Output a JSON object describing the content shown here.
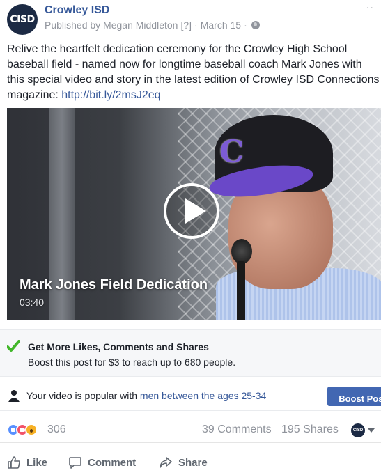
{
  "post": {
    "page_name": "Crowley ISD",
    "avatar_text": "CISD",
    "published_by": "Published by Megan Middleton",
    "help_marker": "[?]",
    "date": "March 15",
    "separator": "·",
    "more_icon": "more-dots-icon",
    "text_main": "Relive the heartfelt dedication ceremony for the Crowley High School baseball field - named now for longtime baseball coach Mark Jones with this special video and story in the latest edition of Crowley ISD Connections magazine: ",
    "text_link": "http://bit.ly/2msJ2eq"
  },
  "video": {
    "title": "Mark Jones Field Dedication",
    "duration": "03:40",
    "cap_letter": "C"
  },
  "boost_tip": {
    "title": "Get More Likes, Comments and Shares",
    "body": "Boost this post for $3 to reach up to 680 people."
  },
  "popular": {
    "text": "Your video is popular with ",
    "audience": "men between the ages 25-34",
    "button_label": "Boost Post"
  },
  "stats": {
    "reaction_count": "306",
    "comments": "39 Comments",
    "shares": "195 Shares",
    "avatar_text": "CISD"
  },
  "actions": {
    "like": "Like",
    "comment": "Comment",
    "share": "Share"
  },
  "colors": {
    "link": "#365899",
    "boost_button": "#4267b2",
    "like_reaction": "#5890ff",
    "love_reaction": "#f25268",
    "wow_reaction": "#f7b125",
    "check_green": "#42b72a"
  }
}
